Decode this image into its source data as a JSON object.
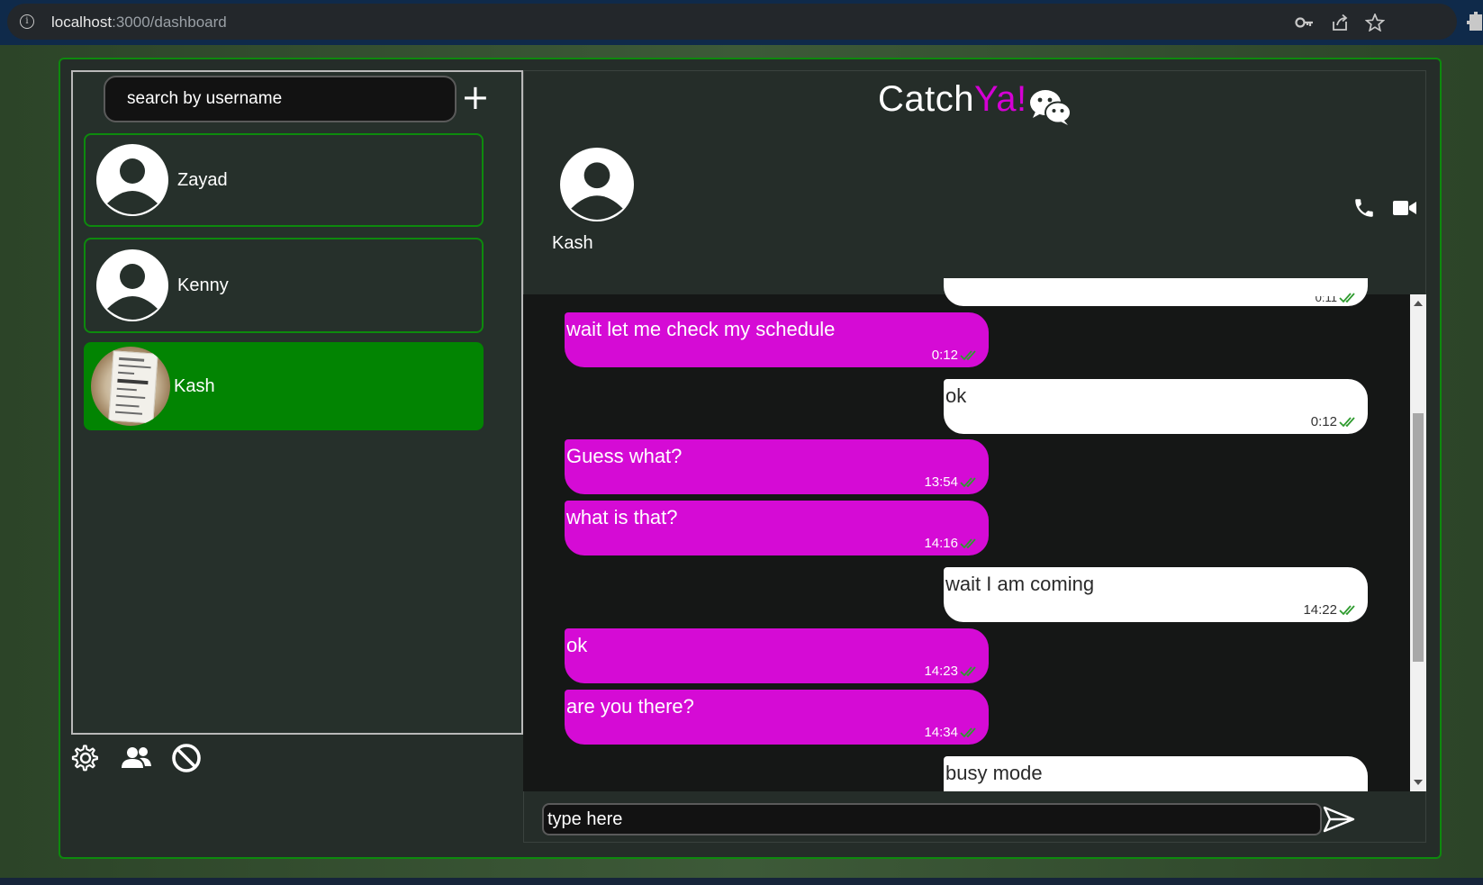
{
  "browser": {
    "url_host": "localhost",
    "url_path": ":3000/dashboard",
    "icons": [
      "info-icon",
      "key-icon",
      "share-icon",
      "star-icon",
      "extensions-icon"
    ]
  },
  "sidebar": {
    "search_placeholder": "search by username",
    "add_label": "+",
    "contacts": [
      {
        "name": "Zayad",
        "avatar": "default-user-icon",
        "active": false
      },
      {
        "name": "Kenny",
        "avatar": "default-user-icon",
        "active": false
      },
      {
        "name": "Kash",
        "avatar": "photo",
        "active": true
      }
    ],
    "bottom_icons": [
      "settings-icon",
      "group-icon",
      "block-icon"
    ]
  },
  "header": {
    "brand_main": "Catch",
    "brand_accent": "Ya!",
    "brand_logo": "wechat-icon",
    "peer_name": "Kash",
    "actions": [
      "phone-icon",
      "video-icon"
    ]
  },
  "messages": [
    {
      "direction": "received",
      "text": "",
      "time": "0:11",
      "read": true,
      "partial": "top"
    },
    {
      "direction": "sent",
      "text": "wait let me check my schedule",
      "time": "0:12",
      "read": true
    },
    {
      "direction": "received",
      "text": "ok",
      "time": "0:12",
      "read": true
    },
    {
      "direction": "sent",
      "text": "Guess what?",
      "time": "13:54",
      "read": true
    },
    {
      "direction": "sent",
      "text": "what is that?",
      "time": "14:16",
      "read": true
    },
    {
      "direction": "received",
      "text": "wait I am coming",
      "time": "14:22",
      "read": true
    },
    {
      "direction": "sent",
      "text": "ok",
      "time": "14:23",
      "read": true
    },
    {
      "direction": "sent",
      "text": "are you there?",
      "time": "14:34",
      "read": true
    },
    {
      "direction": "received",
      "text": "busy mode",
      "time": "",
      "read": true,
      "partial": "bottom"
    }
  ],
  "composer": {
    "placeholder": "type here",
    "send_icon": "send-icon"
  },
  "colors": {
    "accent_green": "#028402",
    "sent_bubble": "#d50bd5",
    "received_bubble": "#ffffff",
    "brand_accent": "#d400d4",
    "read_tick": "#2e9b2e"
  }
}
